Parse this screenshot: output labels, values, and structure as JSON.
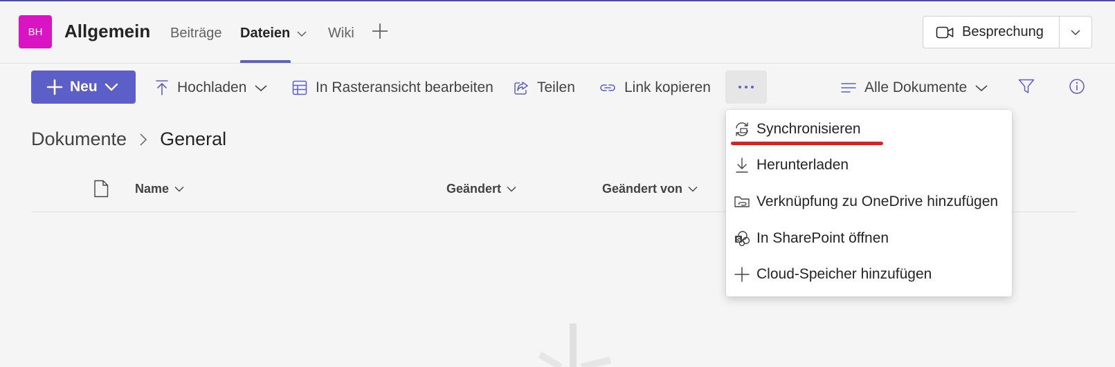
{
  "channel": {
    "avatar_initials": "BH",
    "avatar_color": "#d915c3",
    "title": "Allgemein"
  },
  "tabs": [
    {
      "label": "Beiträge"
    },
    {
      "label": "Dateien",
      "active": true
    },
    {
      "label": "Wiki"
    }
  ],
  "meeting": {
    "label": "Besprechung"
  },
  "toolbar": {
    "new_label": "Neu",
    "upload_label": "Hochladen",
    "grid_label": "In Rasteransicht bearbeiten",
    "share_label": "Teilen",
    "copy_link_label": "Link kopieren",
    "view_label": "Alle Dokumente"
  },
  "breadcrumb": {
    "root": "Dokumente",
    "current": "General"
  },
  "columns": {
    "name": "Name",
    "modified": "Geändert",
    "modified_by": "Geändert von"
  },
  "menu": {
    "items": [
      {
        "label": "Synchronisieren",
        "icon": "sync-icon",
        "highlighted": true
      },
      {
        "label": "Herunterladen",
        "icon": "download-icon"
      },
      {
        "label": "Verknüpfung zu OneDrive hinzufügen",
        "icon": "shortcut-icon"
      },
      {
        "label": "In SharePoint öffnen",
        "icon": "sharepoint-icon"
      },
      {
        "label": "Cloud-Speicher hinzufügen",
        "icon": "plus-icon"
      }
    ]
  },
  "colors": {
    "accent": "#5b5fc7",
    "highlight": "#e02020"
  }
}
